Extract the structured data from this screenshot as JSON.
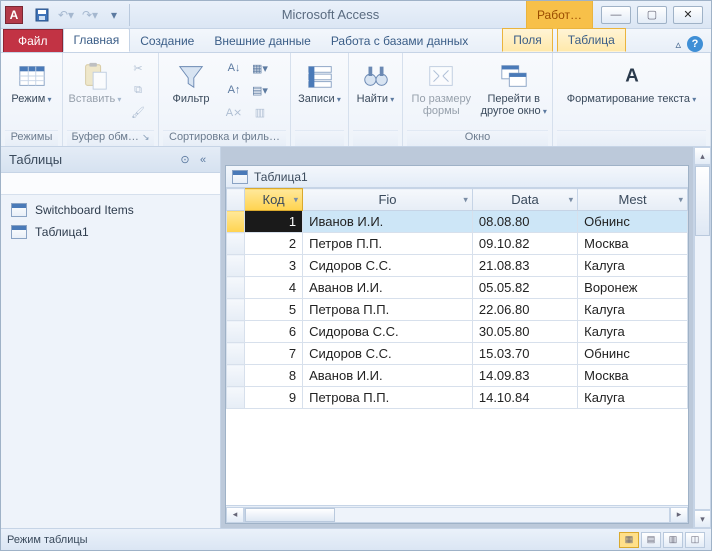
{
  "titlebar": {
    "app_title": "Microsoft Access",
    "context_title": "Работ…"
  },
  "tabs": {
    "file": "Файл",
    "items": [
      "Главная",
      "Создание",
      "Внешние данные",
      "Работа с базами данных"
    ],
    "context_items": [
      "Поля",
      "Таблица"
    ],
    "active_index": 0
  },
  "ribbon": {
    "groups": {
      "modes": {
        "label": "Режимы",
        "btn": "Режим"
      },
      "clipboard": {
        "label": "Буфер обм…",
        "btn": "Вставить"
      },
      "sortfilter": {
        "label": "Сортировка и филь…",
        "btn": "Фильтр"
      },
      "records": {
        "label": "",
        "btn": "Записи"
      },
      "find": {
        "label": "",
        "btn": "Найти"
      },
      "window": {
        "label": "Окно",
        "btn_fit": "По размеру формы",
        "btn_switch": "Перейти в другое окно"
      },
      "textfmt": {
        "label": "",
        "btn": "Форматирование текста"
      }
    }
  },
  "nav": {
    "header": "Таблицы",
    "items": [
      "Switchboard Items",
      "Таблица1"
    ]
  },
  "subwindow": {
    "title": "Таблица1"
  },
  "grid": {
    "columns": [
      "Код",
      "Fio",
      "Data",
      "Mest"
    ],
    "selected_column": 0,
    "selected_row": 0,
    "rows": [
      {
        "code": "1",
        "fio": "Иванов И.И.",
        "data": "08.08.80",
        "mesto": "Обнинс"
      },
      {
        "code": "2",
        "fio": "Петров П.П.",
        "data": "09.10.82",
        "mesto": "Москва"
      },
      {
        "code": "3",
        "fio": "Сидоров С.С.",
        "data": "21.08.83",
        "mesto": "Калуга"
      },
      {
        "code": "4",
        "fio": "Аванов И.И.",
        "data": "05.05.82",
        "mesto": "Воронеж"
      },
      {
        "code": "5",
        "fio": "Петрова П.П.",
        "data": "22.06.80",
        "mesto": "Калуга"
      },
      {
        "code": "6",
        "fio": "Сидорова С.С.",
        "data": "30.05.80",
        "mesto": "Калуга"
      },
      {
        "code": "7",
        "fio": "Сидоров С.С.",
        "data": "15.03.70",
        "mesto": "Обнинс"
      },
      {
        "code": "8",
        "fio": "Аванов И.И.",
        "data": "14.09.83",
        "mesto": "Москва"
      },
      {
        "code": "9",
        "fio": "Петрова П.П.",
        "data": "14.10.84",
        "mesto": "Калуга"
      }
    ]
  },
  "statusbar": {
    "text": "Режим таблицы"
  }
}
